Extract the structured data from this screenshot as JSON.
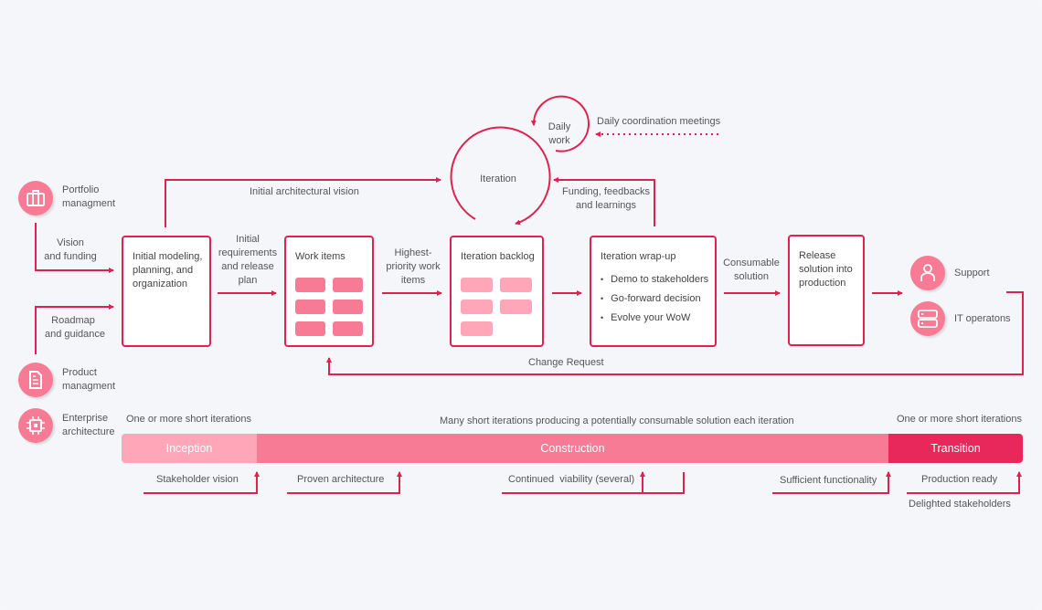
{
  "roles_left": [
    {
      "icon": "briefcase-icon",
      "label_1": "Portfolio",
      "label_2": "managment"
    },
    {
      "icon": "document-icon",
      "label_1": "Product",
      "label_2": "managment"
    },
    {
      "icon": "chip-icon",
      "label_1": "Enterprise",
      "label_2": "architecture"
    }
  ],
  "roles_right": [
    {
      "icon": "user-icon",
      "label": "Support"
    },
    {
      "icon": "server-icon",
      "label": "IT operatons"
    }
  ],
  "flow_labels": {
    "vision_funding_1": "Vision",
    "vision_funding_2": "and funding",
    "roadmap_1": "Roadmap",
    "roadmap_2": "and guidance",
    "initial_arch_vision": "Initial architectural vision",
    "init_req_1": "Initial",
    "init_req_2": "requirements",
    "init_req_3": "and release",
    "init_req_4": "plan",
    "highest_1": "Highest-",
    "highest_2": "priority work",
    "highest_3": "items",
    "daily_work_1": "Daily",
    "daily_work_2": "work",
    "daily_coord": "Daily coordination meetings",
    "iteration": "Iteration",
    "funding_1": "Funding, feedbacks",
    "funding_2": "and learnings",
    "consumable_1": "Consumable",
    "consumable_2": "solution",
    "change_request": "Change Request"
  },
  "boxes": {
    "initial_modeling": [
      "Initial modeling,",
      "planning, and",
      "organization"
    ],
    "work_items": "Work items",
    "iteration_backlog": "Iteration backlog",
    "wrapup": {
      "title": "Iteration wrap-up",
      "bullets": [
        "Demo to stakeholders",
        "Go-forward decision",
        "Evolve your WoW"
      ]
    },
    "release": [
      "Release",
      "solution into",
      "production"
    ]
  },
  "phases": {
    "inception": {
      "label": "Inception",
      "note": "One or more short iterations",
      "color": "#ffa6b8"
    },
    "construction": {
      "label": "Construction",
      "note": "Many short iterations producing a potentially consumable solution each iteration",
      "color": "#f77b94"
    },
    "transition": {
      "label": "Transition",
      "note": "One or more short iterations",
      "color": "#e8275a"
    }
  },
  "milestones": {
    "stakeholder_vision": "Stakeholder vision",
    "proven_architecture": "Proven architecture",
    "continued_viability": "Continued  viability (several)",
    "sufficient_functionality": "Sufficient functionality",
    "production_ready": "Production ready",
    "delighted_stakeholders": "Delighted stakeholders"
  },
  "colors": {
    "accent": "#e0204f",
    "icon_bg": "#f77b94"
  }
}
